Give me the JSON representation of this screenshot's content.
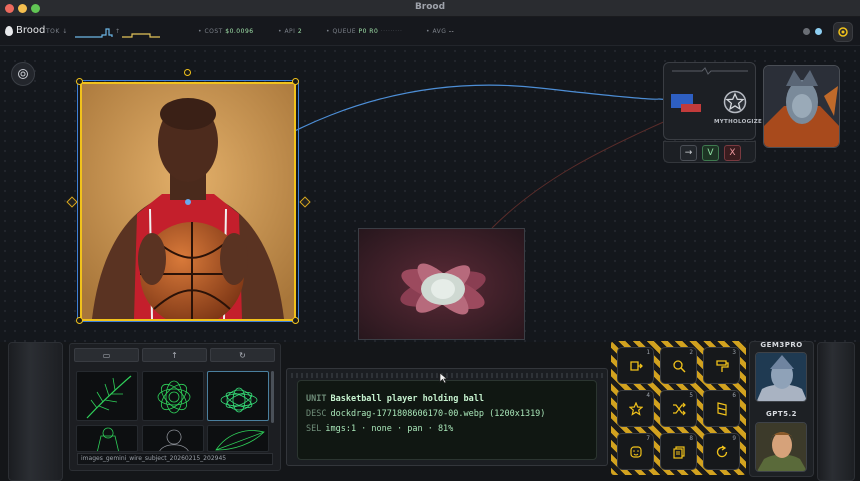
{
  "window": {
    "title": "Brood"
  },
  "hud": {
    "brand": "Brood",
    "tok_label": "TOK ↓",
    "tok_up": "↑",
    "cost_label": "COST",
    "cost_value": "$0.0096",
    "api_label": "API",
    "api_value": "2",
    "queue_label": "QUEUE",
    "queue_value": "P0 R0",
    "avg_label": "AVG",
    "avg_value": "--"
  },
  "canvas": {
    "selected_image": "Basketball player holding ball",
    "secondary_image": "succulent"
  },
  "node": {
    "label": "MYTHOLOGIZE",
    "actions": [
      {
        "icon": "arrow-right-icon",
        "glyph": "→"
      },
      {
        "icon": "accept-icon",
        "glyph": "V"
      },
      {
        "icon": "reject-icon",
        "glyph": "X"
      }
    ]
  },
  "file_browser": {
    "buttons": [
      {
        "icon": "folder-icon",
        "glyph": "▭"
      },
      {
        "icon": "upload-icon",
        "glyph": "↑"
      },
      {
        "icon": "refresh-icon",
        "glyph": "↻"
      }
    ],
    "caption": "images_gemini_wire_subject_20260215_202945"
  },
  "info": {
    "unit_key": "UNIT",
    "unit_value": "Basketball player holding ball",
    "desc_key": "DESC",
    "desc_value": "dockdrag-1771808606170-00.webp (1200x1319)",
    "sel_key": "SEL",
    "sel_value": "imgs:1 · none · pan · 81%"
  },
  "tools": [
    {
      "num": "1",
      "icon": "annotate-icon"
    },
    {
      "num": "2",
      "icon": "search-icon"
    },
    {
      "num": "3",
      "icon": "paint-roller-icon"
    },
    {
      "num": "4",
      "icon": "magic-star-icon"
    },
    {
      "num": "5",
      "icon": "shuffle-icon"
    },
    {
      "num": "6",
      "icon": "stencil-icon"
    },
    {
      "num": "7",
      "icon": "face-icon"
    },
    {
      "num": "8",
      "icon": "layers-icon"
    },
    {
      "num": "9",
      "icon": "rotate-icon"
    }
  ],
  "models": [
    {
      "name": "GEM3PRO"
    },
    {
      "name": "GPT5.2"
    }
  ],
  "colors": {
    "accent_yellow": "#f1c21b",
    "selection_blue": "#3e7fd6",
    "terminal_green": "#a8e6b8"
  }
}
